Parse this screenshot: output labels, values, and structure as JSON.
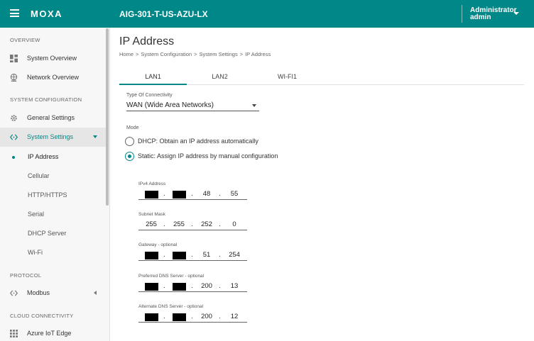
{
  "header": {
    "logo": "MOXA",
    "device_name": "AIG-301-T-US-AZU-LX",
    "user_role": "Administrator",
    "user_name": "admin"
  },
  "sidebar": {
    "sections": {
      "overview": "OVERVIEW",
      "system_configuration": "SYSTEM CONFIGURATION",
      "protocol": "PROTOCOL",
      "cloud_connectivity": "CLOUD CONNECTIVITY"
    },
    "items": {
      "system_overview": "System Overview",
      "network_overview": "Network Overview",
      "general_settings": "General Settings",
      "system_settings": "System Settings",
      "modbus": "Modbus",
      "azure_iot_edge": "Azure IoT Edge"
    },
    "sub_items": [
      "IP Address",
      "Cellular",
      "HTTP/HTTPS",
      "Serial",
      "DHCP Server",
      "Wi-Fi"
    ]
  },
  "main": {
    "title": "IP Address",
    "breadcrumb": [
      "Home",
      "System Configuration",
      "System Settings",
      "IP Address"
    ],
    "tabs": [
      "LAN1",
      "LAN2",
      "WI-FI1"
    ],
    "connectivity": {
      "label": "Type Of Connectivity",
      "value": "WAN (Wide Area Networks)"
    },
    "mode": {
      "label": "Mode",
      "dhcp_label": "DHCP: Obtain an IP address automatically",
      "static_label": "Static: Assign IP address by manual configuration",
      "selected": "static"
    },
    "ipv4": {
      "label": "IPv4 Address",
      "octets": [
        "",
        "",
        "48",
        "55"
      ]
    },
    "subnet": {
      "label": "Subnet Mask",
      "octets": [
        "255",
        "255",
        "252",
        "0"
      ]
    },
    "gateway": {
      "label": "Gateway - optional",
      "octets": [
        "",
        "",
        "51",
        "254"
      ]
    },
    "dns1": {
      "label": "Preferred DNS Server - optional",
      "octets": [
        "",
        "",
        "200",
        "13"
      ]
    },
    "dns2": {
      "label": "Alternate DNS Server - optional",
      "octets": [
        "",
        "",
        "200",
        "12"
      ]
    },
    "dot": "."
  }
}
